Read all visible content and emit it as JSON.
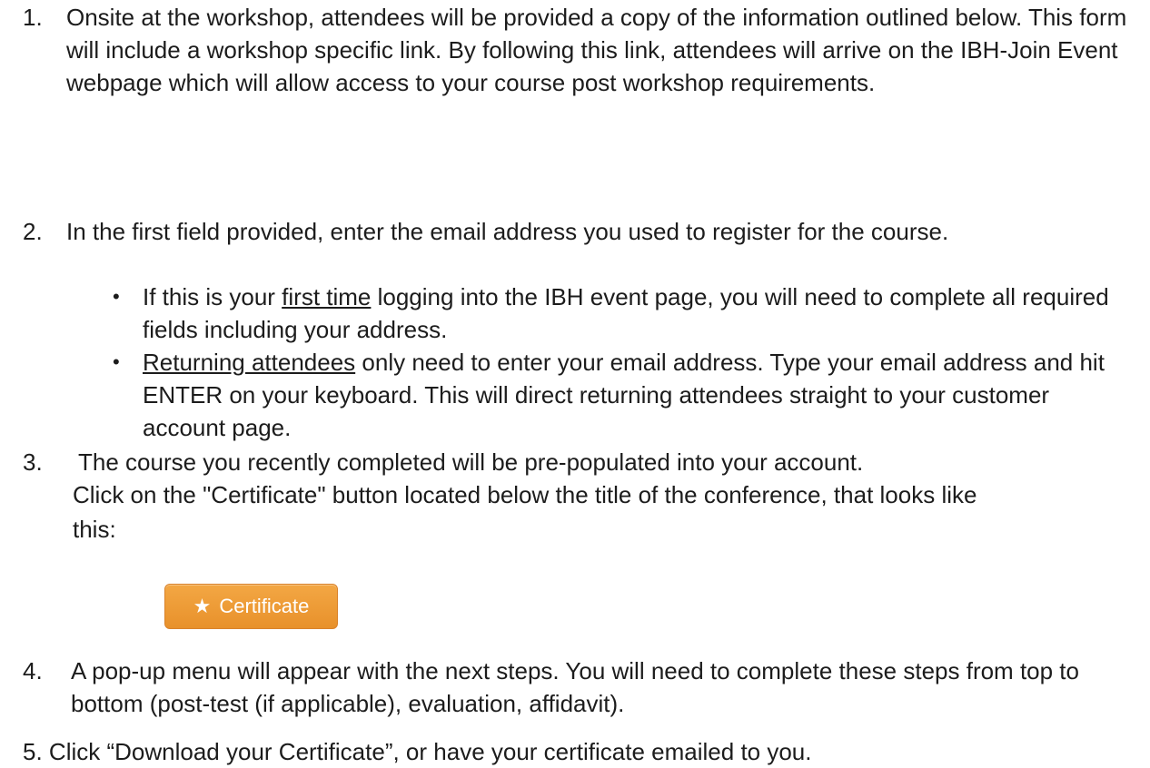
{
  "steps": [
    {
      "number": "1.",
      "text": "Onsite at the workshop, attendees will be provided a copy of the information outlined below. This form will include a workshop specific link. By following this link, attendees will arrive on the IBH-Join Event webpage which will allow access to your course post workshop requirements."
    },
    {
      "number": "2.",
      "text": "In the first field provided, enter the email address you used to register for the course.",
      "bullets": [
        {
          "underlined": "first time",
          "before": "If this is your ",
          "after": " logging into the IBH event page, you will need to complete all required fields including your address."
        },
        {
          "underlined": "Returning attendees",
          "before": "",
          "after": " only need to enter your email address. Type your email address and hit ENTER on your keyboard. This will direct returning attendees straight to your customer account page."
        }
      ]
    },
    {
      "number": "3.",
      "line1": "The course you recently completed will be pre-populated into your account.",
      "line2": "Click on the \"Certificate\" button located below the title of the conference, that looks like",
      "line3": "this:"
    },
    {
      "number": "4.",
      "text": "A pop-up menu will appear with the next steps. You will need to complete these steps from top to bottom (post-test (if applicable), evaluation, affidavit)."
    },
    {
      "number": "5.",
      "text": "Click “Download your Certificate”, or have your certificate emailed to you."
    }
  ],
  "certificate_button": {
    "label": "Certificate",
    "icon": "star-icon",
    "color": "#ee9b38"
  }
}
